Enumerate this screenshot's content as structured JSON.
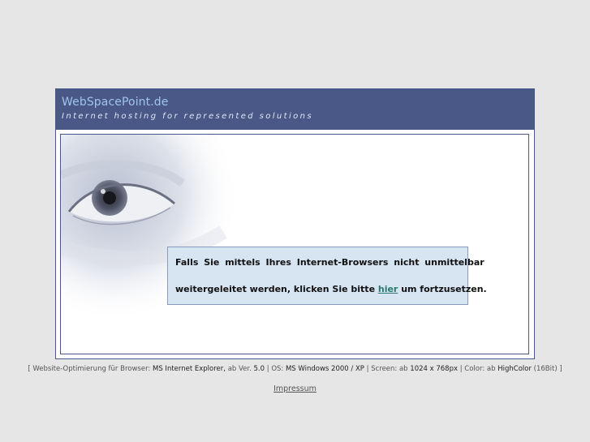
{
  "header": {
    "title": "WebSpacePoint.de",
    "tagline": "Internet hosting for represented solutions"
  },
  "message": {
    "line1": "Falls Sie mittels Ihres Internet-Browsers nicht unmittelbar",
    "line2_prefix": "weitergeleitet werden, klicken Sie bitte ",
    "link_text": "hier",
    "line2_suffix": " um fortzusetzen."
  },
  "footer": {
    "open_bracket": "[",
    "browser_label": "Website-Optimierung für Browser:",
    "browser_value": "MS Internet Explorer,",
    "version_label": "ab Ver.",
    "version_value": "5.0",
    "sep1": "|",
    "os_label": "OS:",
    "os_value": "MS Windows 2000 / XP",
    "sep2": "|",
    "screen_label": "Screen: ab",
    "screen_value": "1024 x 768px",
    "sep3": "|",
    "color_label": "Color: ab",
    "color_value": "HighColor",
    "color_bits": "(16Bit)",
    "close_bracket": "]",
    "impressum": "Impressum"
  },
  "colors": {
    "frame": "#4a5888",
    "title": "#9fc4ee",
    "message_bg": "#d7e4f2",
    "link": "#2c7a6e",
    "page_bg": "#e6e6e6"
  }
}
